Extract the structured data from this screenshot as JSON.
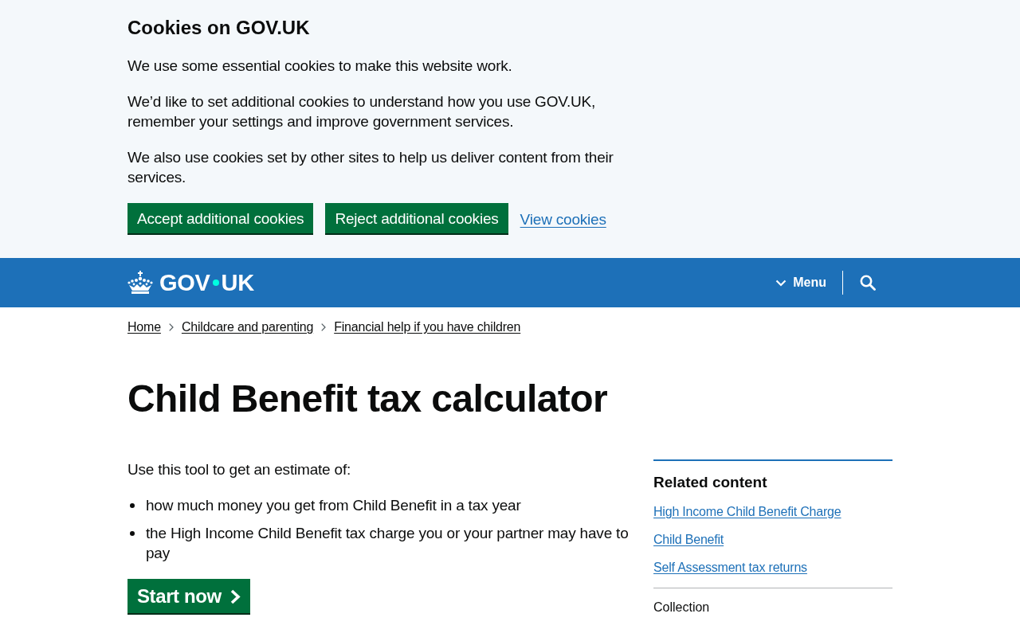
{
  "cookie_banner": {
    "title": "Cookies on GOV.UK",
    "paragraphs": [
      "We use some essential cookies to make this website work.",
      "We’d like to set additional cookies to understand how you use GOV.UK, remember your settings and improve government services.",
      "We also use cookies set by other sites to help us deliver content from their services."
    ],
    "actions": [
      {
        "label": "Accept additional cookies",
        "kind": "button"
      },
      {
        "label": "Reject additional cookies",
        "kind": "button"
      },
      {
        "label": "View cookies",
        "kind": "link"
      }
    ]
  },
  "header": {
    "logo_text": [
      "GOV",
      "UK"
    ],
    "menu_label": "Menu"
  },
  "breadcrumbs": [
    "Home",
    "Childcare and parenting",
    "Financial help if you have children"
  ],
  "title": "Child Benefit tax calculator",
  "main": {
    "intro": "Use this tool to get an estimate of:",
    "bullets": [
      "how much money you get from Child Benefit in a tax year",
      "the High Income Child Benefit tax charge you or your partner may have to pay"
    ],
    "start_button": "Start now"
  },
  "related": {
    "title": "Related content",
    "links": [
      "High Income Child Benefit Charge",
      "Child Benefit",
      "Self Assessment tax returns"
    ],
    "collection_label": "Collection"
  }
}
